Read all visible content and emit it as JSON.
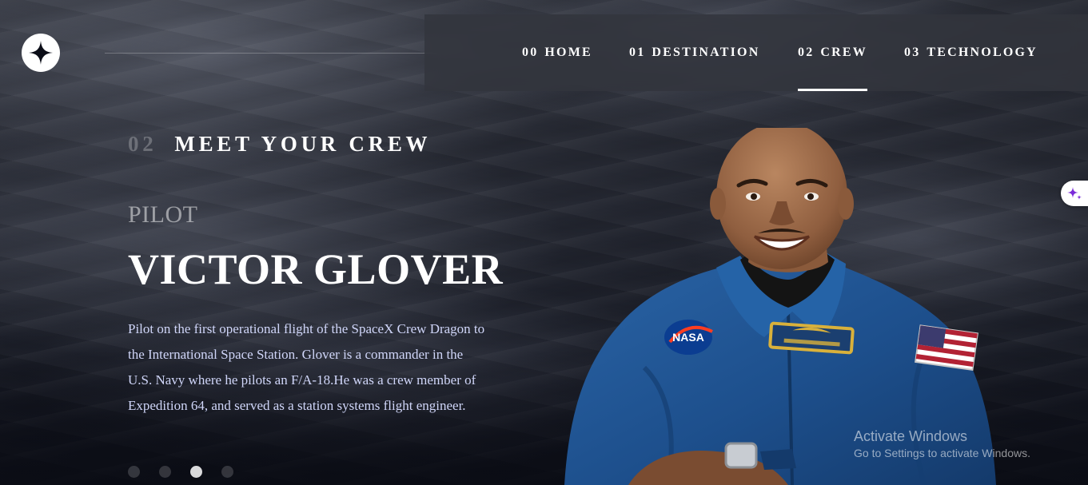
{
  "header": {
    "logo_icon": "star-icon",
    "nav": [
      {
        "num": "00",
        "label": "HOME",
        "active": false
      },
      {
        "num": "01",
        "label": "DESTINATION",
        "active": false
      },
      {
        "num": "02",
        "label": "CREW",
        "active": true
      },
      {
        "num": "03",
        "label": "TECHNOLOGY",
        "active": false
      }
    ]
  },
  "main": {
    "eyebrow_num": "02",
    "eyebrow_label": "MEET YOUR CREW",
    "role": "PILOT",
    "name": "VICTOR GLOVER",
    "bio": "Pilot on the first operational flight of the SpaceX Crew Dragon to the International Space Station. Glover is a commander in the U.S. Navy where he pilots an F/A-18.He was a crew member of Expedition 64, and served as a station systems flight engineer.",
    "slides_count": 4,
    "active_slide": 3
  },
  "side_widget": {
    "icon": "sparkle-icon",
    "color": "#7b2bd9"
  },
  "watermark": {
    "title": "Activate Windows",
    "subtitle": "Go to Settings to activate Windows."
  },
  "colors": {
    "accent": "#ffffff",
    "nav_bg": "#32343c",
    "body_text": "#d0d6f9",
    "suit_blue": "#1d4f8c"
  }
}
